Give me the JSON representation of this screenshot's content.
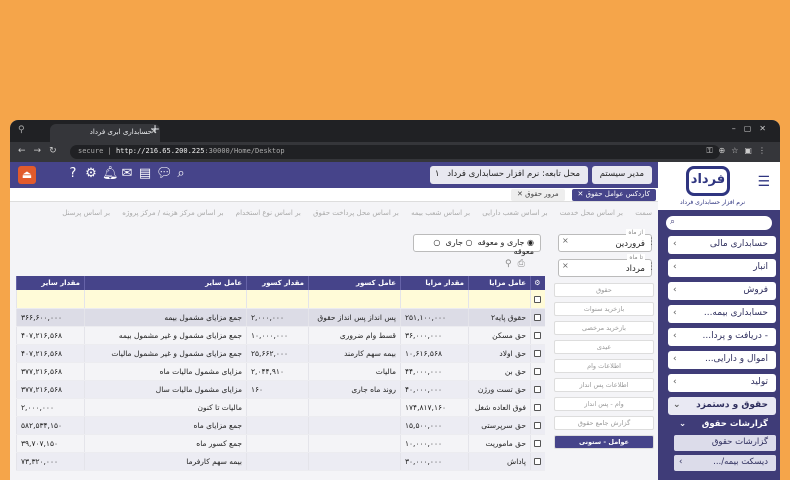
{
  "browser": {
    "tab_title": "حسابداری ابری فرداد",
    "secure_label": "secure",
    "url_host": "http://216.65.200.225",
    "url_path": ":30000/Home/Desktop"
  },
  "sidebar": {
    "brand_mark": "فرداد",
    "brand_sub": "نرم افزار حسابداری فرداد",
    "items": [
      {
        "label": "حسابداری مالی"
      },
      {
        "label": "انبار"
      },
      {
        "label": "فروش"
      },
      {
        "label": "حسابداری بیمه..."
      },
      {
        "label": "- دریافت و پردا..."
      },
      {
        "label": "اموال و دارایی..."
      },
      {
        "label": "تولید"
      }
    ],
    "active_item": "حقوق و دستمزد",
    "sub_reports": "گزارشات حقوق",
    "sub_items": [
      {
        "label": "گزارشات حقوق"
      },
      {
        "label": "دیسکت بیمه/..."
      }
    ]
  },
  "topbar": {
    "user": "مدیر سیستم",
    "office": "محل تابعه: نرم افزار حسابداری فرداد",
    "year": "۱۴۰۲"
  },
  "tabs": {
    "active": "کاردکس عوامل حقوق",
    "second": "مرور حقوق"
  },
  "filters": [
    "سمت",
    "بر اساس محل خدمت",
    "بر اساس شعب دارایی",
    "بر اساس شعب بیمه",
    "بر اساس محل پرداخت حقوق",
    "بر اساس نوع استخدام",
    "بر اساس مرکز هزینه / مرکز پروژه",
    "بر اساس پرسنل"
  ],
  "radios": {
    "opt1": "جاری و معوقه",
    "opt2": "جاری",
    "opt3": "معوقه"
  },
  "months": {
    "from_label": "از ماه",
    "from_value": "فروردین",
    "to_label": "تا ماه",
    "to_value": "مرداد"
  },
  "right_list": [
    {
      "label": "حقوق"
    },
    {
      "label": "بازخرید سنوات"
    },
    {
      "label": "بازخرید مرخصی"
    },
    {
      "label": "عیدی"
    },
    {
      "label": "اطلاعات وام"
    },
    {
      "label": "اطلاعات پس انداز"
    },
    {
      "label": "وام - پس انداز"
    },
    {
      "label": "گزارش جامع حقوق"
    },
    {
      "label": "عوامل - ستونی"
    }
  ],
  "grid": {
    "headers": [
      "",
      "عامل مزایا",
      "مقدار مزایا",
      "عامل کسور",
      "مقدار کسور",
      "عامل سایر",
      "مقدار سایر"
    ],
    "rows": [
      [
        "حقوق پایه۲",
        "۲۵۱,۱۰۰,۰۰۰",
        "پس انداز پس انداز حقوق",
        "۲,۰۰۰,۰۰۰",
        "جمع مزایای مشمول بیمه",
        "۳۶۶,۶۰۰,۰۰۰"
      ],
      [
        "حق مسکن",
        "۳۶,۰۰۰,۰۰۰",
        "قسط وام ضروری",
        "۱۰,۰۰۰,۰۰۰",
        "جمع مزایای مشمول و غیر مشمول بیمه",
        "۴۰۷,۲۱۶,۵۶۸"
      ],
      [
        "حق اولاد",
        "۱۰,۶۱۶,۵۶۸",
        "بیمه سهم کارمند",
        "۲۵,۶۶۲,۰۰۰",
        "جمع مزایای مشمول و غیر مشمول مالیات",
        "۴۰۷,۲۱۶,۵۶۸"
      ],
      [
        "حق بن",
        "۴۴,۰۰۰,۰۰۰",
        "مالیات",
        "۲,۰۴۴,۹۱۰",
        "مزایای مشمول مالیات ماه",
        "۳۷۷,۲۱۶,۵۶۸"
      ],
      [
        "حق تست ورژن",
        "۴۰,۰۰۰,۰۰۰",
        "روند ماه جاری",
        "۱۶۰",
        "مزایای مشمول مالیات سال",
        "۳۷۷,۲۱۶,۵۶۸"
      ],
      [
        "فوق العاده شغل",
        "۱۷۴,۸۱۷,۱۶۰",
        "",
        "",
        "مالیات تا کنون",
        "۲,۰۰۰,۰۰۰"
      ],
      [
        "حق سرپرستی",
        "۱۵,۵۰۰,۰۰۰",
        "",
        "",
        "جمع مزایای ماه",
        "۵۸۲,۵۳۴,۱۵۰"
      ],
      [
        "حق ماموریت",
        "۱۰,۰۰۰,۰۰۰",
        "",
        "",
        "جمع کسور ماه",
        "۳۹,۷۰۷,۱۵۰"
      ],
      [
        "پاداش",
        "۳۰,۰۰۰,۰۰۰",
        "",
        "",
        "بیمه سهم کارفرما",
        "۷۳,۳۲۰,۰۰۰"
      ]
    ]
  }
}
